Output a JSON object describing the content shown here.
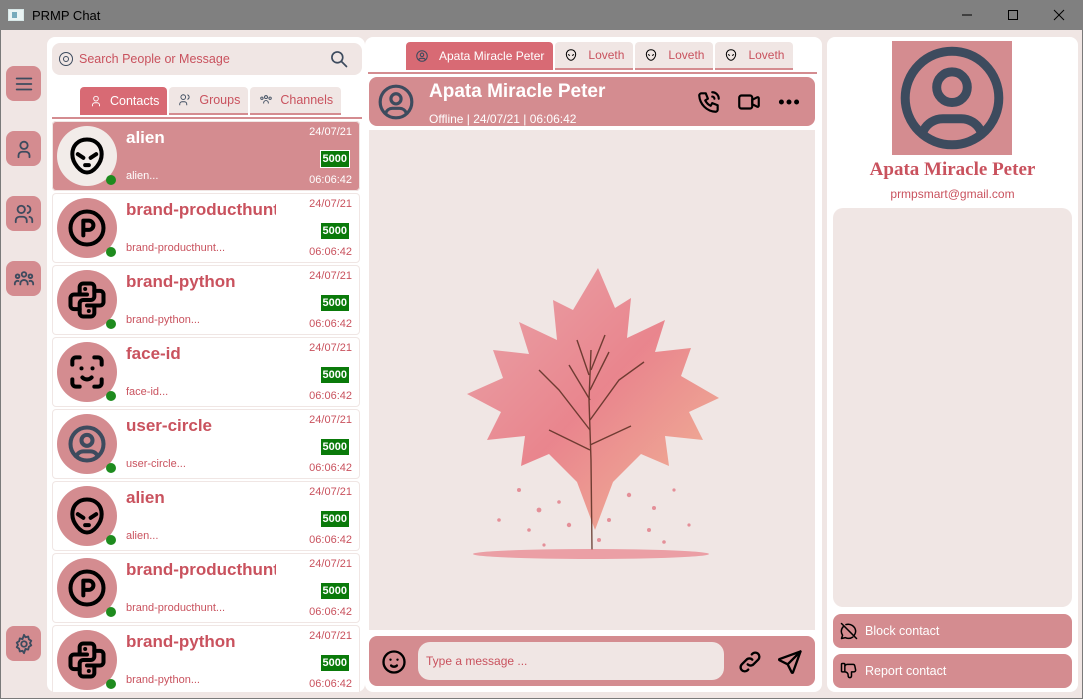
{
  "window": {
    "title": "PRMP Chat",
    "min_icon": "minimize-icon",
    "max_icon": "maximize-icon",
    "close_icon": "close-icon"
  },
  "colors": {
    "accent": "#d48c90",
    "accent_active": "#d86a74",
    "text_accent": "#c9525e",
    "panel_bg": "#f0e6e4",
    "online": "#1e8b1e",
    "badge": "#0a7a0a",
    "icon": "#3d4b5e"
  },
  "rail": {
    "items": [
      {
        "icon": "menu-icon"
      },
      {
        "icon": "user-icon"
      },
      {
        "icon": "users-icon"
      },
      {
        "icon": "user-group-icon"
      },
      {
        "icon": "settings-icon"
      }
    ]
  },
  "search": {
    "placeholder": "Search People or Message",
    "value": ""
  },
  "list_tabs": [
    {
      "label": "Contacts",
      "icon": "user-icon",
      "active": true
    },
    {
      "label": "Groups",
      "icon": "users-icon",
      "active": false
    },
    {
      "label": "Channels",
      "icon": "user-group-icon",
      "active": false
    }
  ],
  "contacts": [
    {
      "name": "alien",
      "preview": "alien...",
      "date": "24/07/21",
      "badge": "5000",
      "time": "06:06:42",
      "icon": "alien-icon",
      "online": true,
      "active": true
    },
    {
      "name": "brand-producthunt",
      "preview": "brand-producthunt...",
      "date": "24/07/21",
      "badge": "5000",
      "time": "06:06:42",
      "icon": "producthunt-icon",
      "online": true,
      "active": false
    },
    {
      "name": "brand-python",
      "preview": "brand-python...",
      "date": "24/07/21",
      "badge": "5000",
      "time": "06:06:42",
      "icon": "python-icon",
      "online": true,
      "active": false
    },
    {
      "name": "face-id",
      "preview": "face-id...",
      "date": "24/07/21",
      "badge": "5000",
      "time": "06:06:42",
      "icon": "face-id-icon",
      "online": true,
      "active": false
    },
    {
      "name": "user-circle",
      "preview": "user-circle...",
      "date": "24/07/21",
      "badge": "5000",
      "time": "06:06:42",
      "icon": "user-circle-icon",
      "online": true,
      "active": false
    },
    {
      "name": "alien",
      "preview": "alien...",
      "date": "24/07/21",
      "badge": "5000",
      "time": "06:06:42",
      "icon": "alien-icon",
      "online": true,
      "active": false
    },
    {
      "name": "brand-producthunt",
      "preview": "brand-producthunt...",
      "date": "24/07/21",
      "badge": "5000",
      "time": "06:06:42",
      "icon": "producthunt-icon",
      "online": true,
      "active": false
    },
    {
      "name": "brand-python",
      "preview": "brand-python...",
      "date": "24/07/21",
      "badge": "5000",
      "time": "06:06:42",
      "icon": "python-icon",
      "online": true,
      "active": false
    }
  ],
  "chat_tabs": [
    {
      "label": "Apata Miracle Peter",
      "icon": "user-circle-icon",
      "active": true
    },
    {
      "label": "Loveth",
      "icon": "alien-icon",
      "active": false
    },
    {
      "label": "Loveth",
      "icon": "alien-icon",
      "active": false
    },
    {
      "label": "Loveth",
      "icon": "alien-icon",
      "active": false
    }
  ],
  "chat_header": {
    "name": "Apata Miracle Peter",
    "status": "Offline | 24/07/21 | 06:06:42",
    "icons": [
      "phone-call-icon",
      "video-icon",
      "more-icon"
    ]
  },
  "chat_body": {
    "background_image": "maple-leaf-tree-illustration"
  },
  "composer": {
    "placeholder": "Type a message ...",
    "value": "",
    "icons": [
      "emoji-icon",
      "link-icon",
      "send-icon"
    ]
  },
  "profile": {
    "name": "Apata Miracle Peter",
    "email": "prmpsmart@gmail.com",
    "block_label": "Block contact",
    "report_label": "Report contact"
  }
}
